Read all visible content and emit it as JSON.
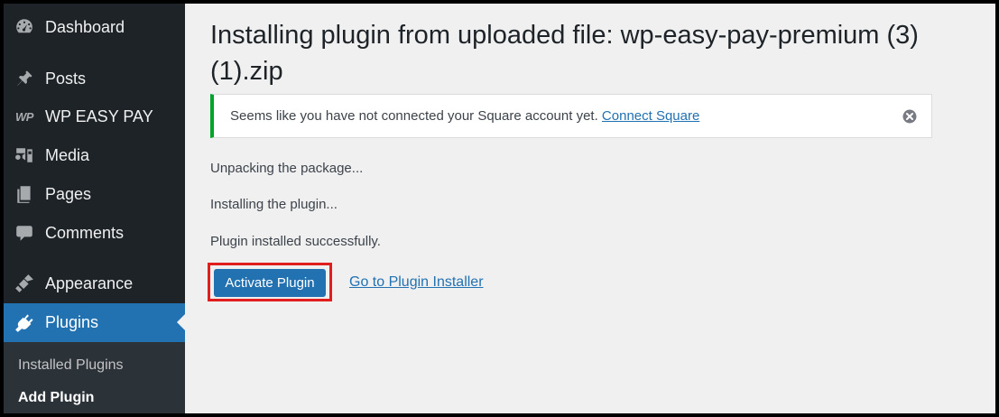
{
  "sidebar": {
    "items": [
      {
        "label": "Dashboard",
        "icon": "dashboard-icon"
      },
      {
        "label": "Posts",
        "icon": "pushpin-icon"
      },
      {
        "label": "WP EASY PAY",
        "icon": "wp-easy-pay-icon",
        "badge": "WP"
      },
      {
        "label": "Media",
        "icon": "media-icon"
      },
      {
        "label": "Pages",
        "icon": "pages-icon"
      },
      {
        "label": "Comments",
        "icon": "comment-icon"
      },
      {
        "label": "Appearance",
        "icon": "paintbrush-icon"
      },
      {
        "label": "Plugins",
        "icon": "plugin-icon",
        "active": true
      }
    ],
    "submenu": [
      {
        "label": "Installed Plugins"
      },
      {
        "label": "Add Plugin",
        "current": true
      }
    ]
  },
  "main": {
    "title": "Installing plugin from uploaded file: wp-easy-pay-premium (3) (1).zip",
    "notice": {
      "text": "Seems like you have not connected your Square account yet.",
      "link": "Connect Square",
      "dismiss_icon": "dismiss-icon"
    },
    "log": [
      "Unpacking the package...",
      "Installing the plugin...",
      "Plugin installed successfully."
    ],
    "activate_button": "Activate Plugin",
    "installer_link": "Go to Plugin Installer"
  },
  "colors": {
    "sidebar_bg": "#1d2327",
    "accent": "#2271b1",
    "notice_border": "#00a32a",
    "highlight": "#e01e1e"
  }
}
